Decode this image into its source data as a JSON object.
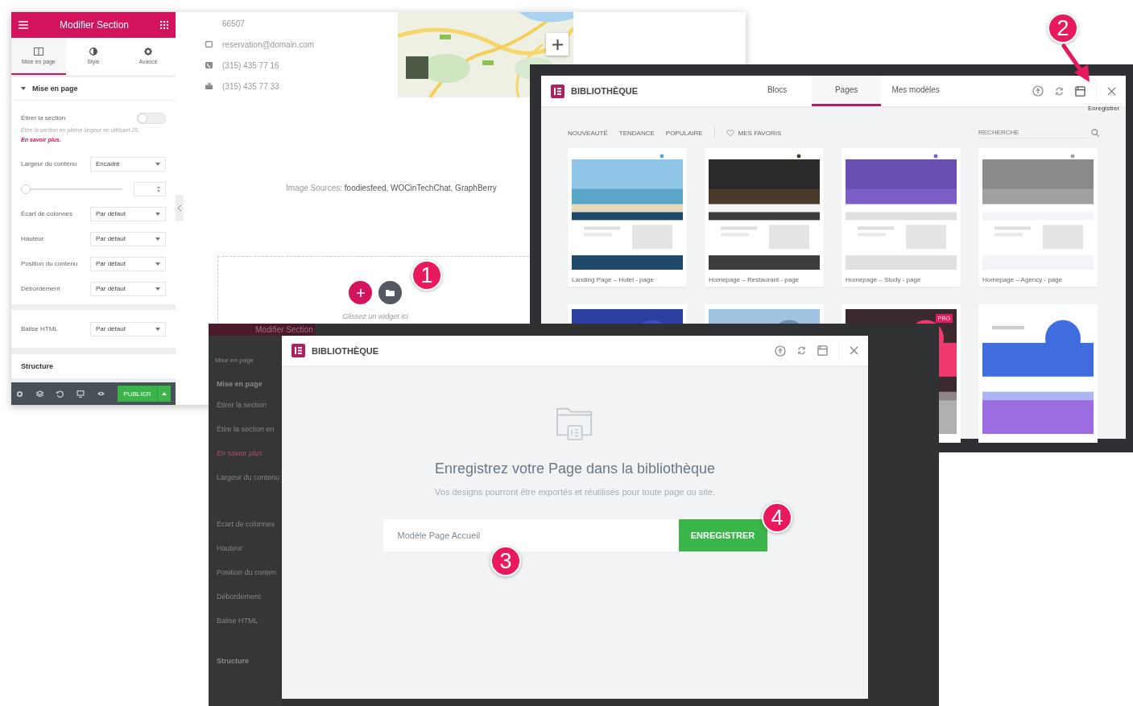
{
  "editor": {
    "panel": {
      "title": "Modifier Section",
      "tabs": [
        {
          "label": "Mise en page",
          "selected": true
        },
        {
          "label": "Style",
          "selected": false
        },
        {
          "label": "Avancé",
          "selected": false
        }
      ],
      "section_title": "Mise en page",
      "stretch": {
        "label": "Étirer la section",
        "on": false
      },
      "help": "Étire la section en pleine largeur en utilisant JS.",
      "help_link": "En savoir plus.",
      "controls": [
        {
          "kind": "select",
          "label": "Largeur du contenu",
          "value": "Encadré"
        },
        {
          "kind": "slider",
          "level": 0
        },
        {
          "kind": "select",
          "label": "Écart de colonnes",
          "value": "Par défaut"
        },
        {
          "kind": "select",
          "label": "Hauteur",
          "value": "Par défaut"
        },
        {
          "kind": "select",
          "label": "Position du contenu",
          "value": "Par défaut"
        },
        {
          "kind": "select",
          "label": "Débordement",
          "value": "Par défaut"
        }
      ],
      "html_tag": {
        "label": "Balise HTML",
        "value": "Par défaut"
      },
      "structure": "Structure",
      "publish": "PUBLIER"
    },
    "contact": [
      {
        "kind": "text",
        "text": "66507"
      },
      {
        "kind": "email",
        "text": "reservation@domain.com"
      },
      {
        "kind": "phone",
        "text": "(315) 435 77 16"
      },
      {
        "kind": "fax",
        "text": "(315) 435 77 33"
      }
    ],
    "image_sources_label": "Image Sources:",
    "image_sources": "foodiesfeed, WOCinTechChat, GraphBerry",
    "drop_hint": "Glissez un widget ici"
  },
  "library": {
    "title": "BIBLIOTHÈQUE",
    "tabs": [
      {
        "label": "Blocs",
        "selected": false
      },
      {
        "label": "Pages",
        "selected": true
      },
      {
        "label": "Mes modèles",
        "selected": false
      }
    ],
    "tooltip": "Enregistrer",
    "filters": [
      {
        "label": "NOUVEAUTÉ",
        "selected": false
      },
      {
        "label": "TENDANCE",
        "selected": false
      },
      {
        "label": "POPULAIRE",
        "selected": false
      }
    ],
    "favorites": "MES FAVORIS",
    "search": {
      "placeholder": "RECHERCHE"
    },
    "templates": [
      {
        "kind": "hotel",
        "title": "Landing Page – Hotel - page"
      },
      {
        "kind": "restaurant",
        "title": "Homepage – Restaurant - page"
      },
      {
        "kind": "study",
        "title": "Homepage – Study - page"
      },
      {
        "kind": "agency",
        "title": "Homepage – Agency - page"
      }
    ],
    "more_templates": [
      {
        "kind": "blue"
      },
      {
        "kind": "sky"
      },
      {
        "kind": "pink",
        "badge": "PRO"
      },
      {
        "kind": "violet"
      }
    ]
  },
  "save_dialog": {
    "background_panel": {
      "title": "Modifier Section",
      "tab": "Mise en page",
      "section": "Mise en page",
      "labels": [
        "Étirer la section",
        "Étire la section en",
        "En savoir plus",
        "Largeur du contenu",
        "Écart de colonnes",
        "Hauteur",
        "Position du conten",
        "Débordement",
        "Balise HTML"
      ],
      "structure": "Structure"
    },
    "title": "BIBLIOTHÈQUE",
    "heading": "Enregistrez votre Page dans la bibliothèque",
    "description": "Vos designs pourront être exportés et réutilisés pour toute page ou site.",
    "name_field": {
      "value": "Modèle Page Accueil"
    },
    "button": "ENREGISTRER"
  },
  "steps": [
    {
      "number": "1"
    },
    {
      "number": "2"
    },
    {
      "number": "3"
    },
    {
      "number": "4"
    }
  ]
}
